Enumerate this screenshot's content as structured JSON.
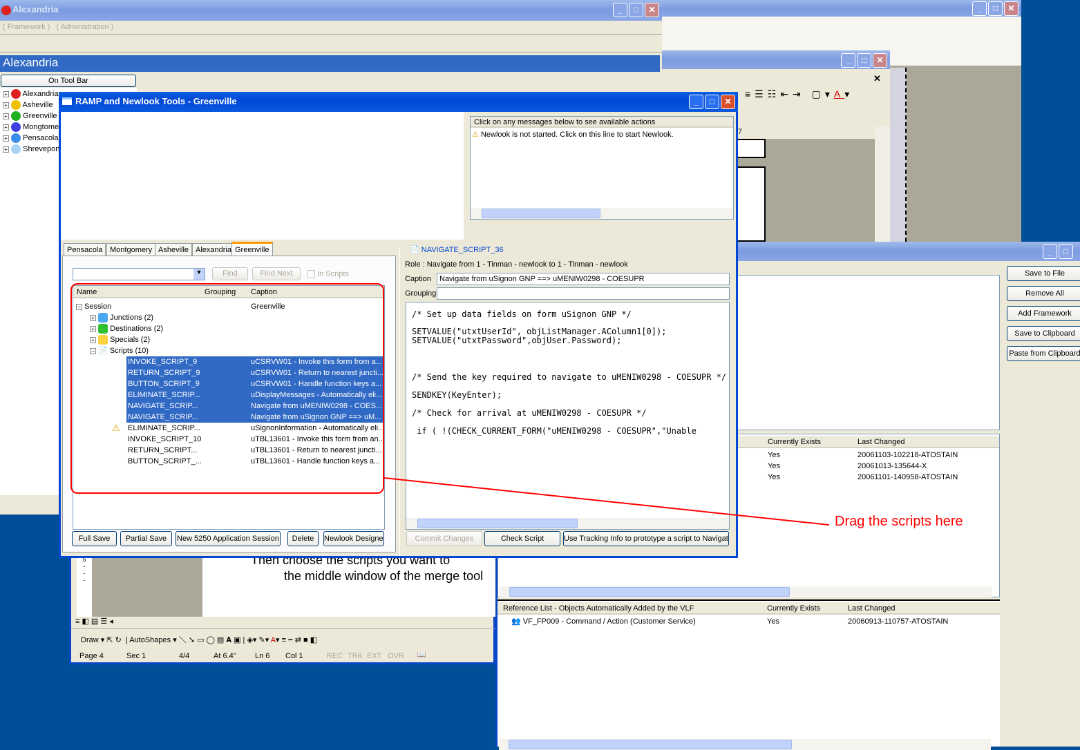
{
  "background_window": {
    "title": ""
  },
  "alexandria": {
    "title": "Alexandria",
    "menu": [
      "( Framework )",
      "( Administration )"
    ],
    "header": "Alexandria",
    "on_tool_bar": "On Tool Bar",
    "tree": [
      {
        "label": "Alexandria",
        "color": "#e02020"
      },
      {
        "label": "Asheville",
        "color": "#f0c000"
      },
      {
        "label": "Greenville",
        "color": "#20b020"
      },
      {
        "label": "Mongtomery",
        "color": "#4040e0"
      },
      {
        "label": "Pensacola",
        "color": "#3a8ee8"
      },
      {
        "label": "Shreveport",
        "color": "#a8d4f8"
      }
    ]
  },
  "word": {
    "ruler_mark": "7",
    "text_line1": "Then choose the scripts you want to",
    "text_line2": "the middle window of the merge tool",
    "draw_label": "Draw",
    "autoshapes_label": "AutoShapes",
    "status": {
      "page": "Page 4",
      "sec": "Sec 1",
      "pages": "4/4",
      "at": "At 6.4\"",
      "ln": "Ln 6",
      "col": "Col 1",
      "rec": "REC",
      "trk": "TRK",
      "ext": "EXT",
      "ovr": "OVR"
    }
  },
  "merge": {
    "buttons": [
      "Save to File",
      "Remove All",
      "Add Framework",
      "Save to Clipboard",
      "Paste from Clipboard"
    ],
    "list_headers": [
      "Currently Exists",
      "Last Changed"
    ],
    "rows": [
      {
        "exists": "Yes",
        "changed": "20061103-102218-ATOSTAIN"
      },
      {
        "exists": "Yes",
        "changed": "20061013-135644-X"
      },
      {
        "exists": "Yes",
        "changed": "20061101-140958-ATOSTAIN"
      }
    ],
    "ref_headers": [
      "Reference List -  Objects Automatically Added by the VLF",
      "Currently Exists",
      "Last Changed"
    ],
    "ref_rows": [
      {
        "name": "VF_FP009 - Command / Action (Customer Service)",
        "exists": "Yes",
        "changed": "20060913-110757-ATOSTAIN"
      }
    ]
  },
  "ramp": {
    "title": "RAMP and Newlook Tools - Greenville",
    "messages_header": "Click on any messages below to see available actions",
    "message": "Newlook is not started. Click on this line to start Newlook.",
    "tabs": [
      "Pensacola",
      "Montgomery",
      "Asheville",
      "Alexandria",
      "Greenville"
    ],
    "active_tab": "Greenville",
    "find": "Find",
    "find_next": "Find Next",
    "in_scripts": "In Scripts",
    "columns": [
      "Name",
      "Grouping",
      "Caption"
    ],
    "session": {
      "label": "Session",
      "caption": "Greenville"
    },
    "groups": [
      {
        "label": "Junctions (2)",
        "color": "#4aa8f0"
      },
      {
        "label": "Destinations (2)",
        "color": "#30c030"
      },
      {
        "label": "Specials (2)",
        "color": "#f8d040"
      }
    ],
    "scripts_label": "Scripts (10)",
    "scripts": [
      {
        "name": "INVOKE_SCRIPT_9",
        "caption": "uCSRVW01 - Invoke this form from a...",
        "selected": true
      },
      {
        "name": "RETURN_SCRIPT_9",
        "caption": "uCSRVW01 - Return to nearest juncti...",
        "selected": true
      },
      {
        "name": "BUTTON_SCRIPT_9",
        "caption": "uCSRVW01 - Handle function keys a...",
        "selected": true
      },
      {
        "name": "ELIMINATE_SCRIP...",
        "caption": "uDisplayMessages - Automatically eli...",
        "selected": true
      },
      {
        "name": "NAVIGATE_SCRIP...",
        "caption": "Navigate from uMENIW0298 - COES...",
        "selected": true
      },
      {
        "name": "NAVIGATE_SCRIP...",
        "caption": "Navigate from uSignon GNP ==> uM...",
        "selected": true
      },
      {
        "name": "ELIMINATE_SCRIP...",
        "caption": "uSignonInformation - Automatically eli...",
        "selected": false,
        "warning": true
      },
      {
        "name": "INVOKE_SCRIPT_10",
        "caption": "uTBL13601 - Invoke this form from an...",
        "selected": false
      },
      {
        "name": "RETURN_SCRIPT...",
        "caption": "uTBL13601 - Return to nearest juncti...",
        "selected": false
      },
      {
        "name": "BUTTON_SCRIPT_...",
        "caption": "uTBL13601 - Handle function keys a...",
        "selected": false
      }
    ],
    "bottom_buttons": [
      "Full Save",
      "Partial Save",
      "New 5250 Application Session",
      "Delete",
      "Newlook Designer"
    ],
    "detail": {
      "script_name": "NAVIGATE_SCRIPT_36",
      "role": "Role : Navigate from 1 - Tinman - newlook to 1 - Tinman - newlook",
      "caption_label": "Caption",
      "caption_value": "Navigate from uSignon GNP ==> uMENIW0298 - COESUPR",
      "grouping_label": "Grouping",
      "grouping_value": "",
      "code": [
        "/* Set up data fields on form uSignon GNP */",
        "SETVALUE(\"utxtUserId\", objListManager.AColumn1[0]);\nSETVALUE(\"utxtPassword\",objUser.Password);",
        "/* Send the key required to navigate to uMENIW0298 - COESUPR */",
        "SENDKEY(KeyEnter);",
        "/* Check for arrival at uMENIW0298 - COESUPR */",
        " if ( !(CHECK_CURRENT_FORM(\"uMENIW0298 - COESUPR\",\"Unable"
      ],
      "buttons": [
        "Commit Changes",
        "Check Script",
        "Use Tracking Info to prototype a script to Navigate"
      ]
    }
  },
  "annotation": {
    "text": "Drag the scripts here",
    "color": "#ff0000"
  }
}
